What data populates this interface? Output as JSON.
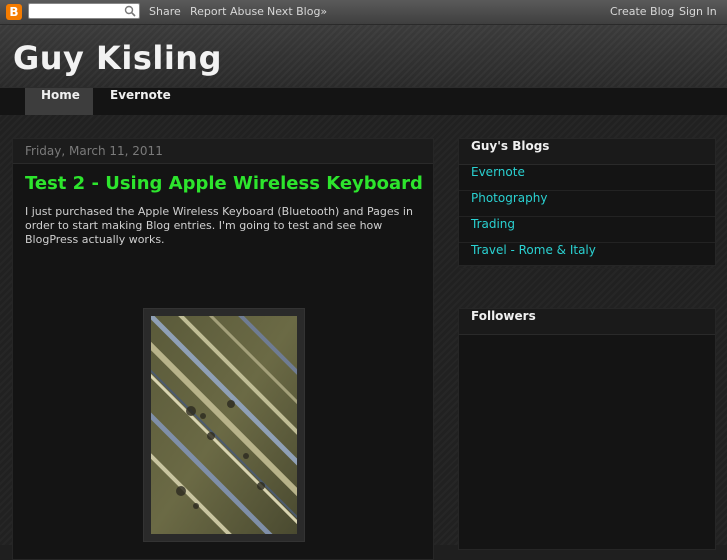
{
  "navbar": {
    "logo": "B",
    "search_value": "",
    "links": [
      "Share",
      "Report Abuse",
      "Next Blog»",
      "Create Blog",
      "Sign In"
    ]
  },
  "header": {
    "title": "Guy Kisling"
  },
  "tabs": [
    {
      "label": "Home",
      "active": true
    },
    {
      "label": "Evernote",
      "active": false
    }
  ],
  "post": {
    "date": "Friday, March 11, 2011",
    "title": "Test 2 - Using Apple Wireless Keyboard",
    "body": "I just purchased the Apple Wireless Keyboard (Bluetooth) and Pages in order to start making Blog entries. I'm going to test and see how BlogPress actually works."
  },
  "sidebar": {
    "blogs_title": "Guy's Blogs",
    "blogs": [
      "Evernote",
      "Photography",
      "Trading",
      "Travel - Rome & Italy"
    ],
    "followers_title": "Followers"
  },
  "colors": {
    "post_title": "#2de52d",
    "sidebar_link": "#2ad1d1"
  }
}
